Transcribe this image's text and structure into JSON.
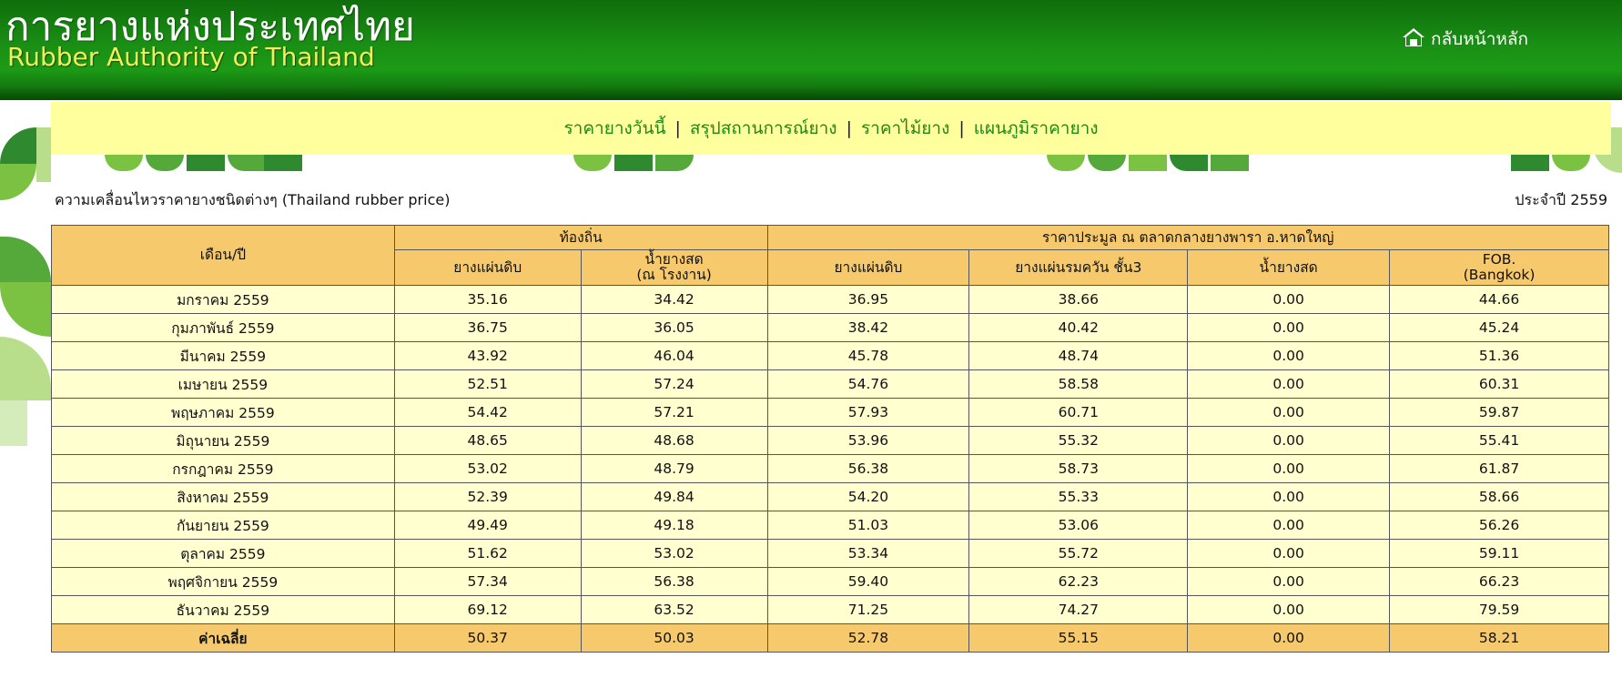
{
  "header": {
    "logo_thai": "การยางแห่งประเทศไทย",
    "logo_english": "Rubber Authority of Thailand",
    "home_label": "กลับหน้าหลัก",
    "home_icon": "home-icon"
  },
  "nav": {
    "items": [
      {
        "label": "ราคายางวันนี้"
      },
      {
        "label": "สรุปสถานการณ์ยาง"
      },
      {
        "label": "ราคาไม้ยาง"
      },
      {
        "label": "แผนภูมิราคายาง"
      }
    ],
    "separator": "|"
  },
  "page": {
    "caption": "ความเคลื่อนไหวราคายางชนิดต่างๆ (Thailand rubber price)",
    "year_label": "ประจำปี 2559"
  },
  "table": {
    "header": {
      "month_year": "เดือน/ปี",
      "local_group": "ท้องถิ่น",
      "auction_group": "ราคาประมูล ณ ตลาดกลางยางพารา อ.หาดใหญ่",
      "local_cols": [
        {
          "line1": "ยางแผ่นดิบ",
          "line2": ""
        },
        {
          "line1": "น้ำยางสด",
          "line2": "(ณ โรงงาน)"
        }
      ],
      "auction_cols": [
        {
          "line1": "ยางแผ่นดิบ",
          "line2": ""
        },
        {
          "line1": "ยางแผ่นรมควัน ชั้น3",
          "line2": ""
        },
        {
          "line1": "น้ำยางสด",
          "line2": ""
        },
        {
          "line1": "FOB.",
          "line2": "(Bangkok)"
        }
      ]
    },
    "rows": [
      {
        "month": "มกราคม 2559",
        "values": [
          "35.16",
          "34.42",
          "36.95",
          "38.66",
          "0.00",
          "44.66"
        ]
      },
      {
        "month": "กุมภาพันธ์ 2559",
        "values": [
          "36.75",
          "36.05",
          "38.42",
          "40.42",
          "0.00",
          "45.24"
        ]
      },
      {
        "month": "มีนาคม 2559",
        "values": [
          "43.92",
          "46.04",
          "45.78",
          "48.74",
          "0.00",
          "51.36"
        ]
      },
      {
        "month": "เมษายน 2559",
        "values": [
          "52.51",
          "57.24",
          "54.76",
          "58.58",
          "0.00",
          "60.31"
        ]
      },
      {
        "month": "พฤษภาคม 2559",
        "values": [
          "54.42",
          "57.21",
          "57.93",
          "60.71",
          "0.00",
          "59.87"
        ]
      },
      {
        "month": "มิถุนายน 2559",
        "values": [
          "48.65",
          "48.68",
          "53.96",
          "55.32",
          "0.00",
          "55.41"
        ]
      },
      {
        "month": "กรกฎาคม 2559",
        "values": [
          "53.02",
          "48.79",
          "56.38",
          "58.73",
          "0.00",
          "61.87"
        ]
      },
      {
        "month": "สิงหาคม 2559",
        "values": [
          "52.39",
          "49.84",
          "54.20",
          "55.33",
          "0.00",
          "58.66"
        ]
      },
      {
        "month": "กันยายน 2559",
        "values": [
          "49.49",
          "49.18",
          "51.03",
          "53.06",
          "0.00",
          "56.26"
        ]
      },
      {
        "month": "ตุลาคม 2559",
        "values": [
          "51.62",
          "53.02",
          "53.34",
          "55.72",
          "0.00",
          "59.11"
        ]
      },
      {
        "month": "พฤศจิกายน 2559",
        "values": [
          "57.34",
          "56.38",
          "59.40",
          "62.23",
          "0.00",
          "66.23"
        ]
      },
      {
        "month": "ธันวาคม 2559",
        "values": [
          "69.12",
          "63.52",
          "71.25",
          "74.27",
          "0.00",
          "79.59"
        ]
      }
    ],
    "average": {
      "label": "ค่าเฉลี่ย",
      "values": [
        "50.37",
        "50.03",
        "52.78",
        "55.15",
        "0.00",
        "58.21"
      ]
    }
  },
  "colors": {
    "header_green": "#1a8f14",
    "nav_background": "#ffff9d",
    "nav_link": "#1c8a14",
    "table_header": "#f6ca6c",
    "table_row": "#ffffd0",
    "logo_english": "#f3ef5a"
  }
}
